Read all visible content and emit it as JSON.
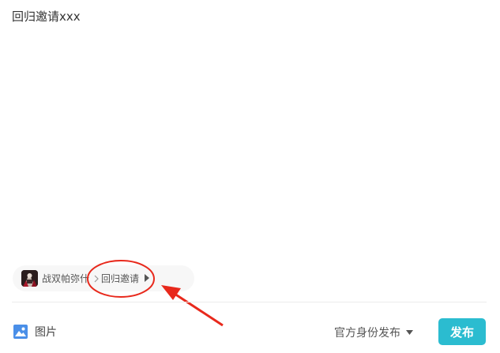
{
  "editor": {
    "content": "回归邀请xxx"
  },
  "topic": {
    "game_name": "战双帕弥什",
    "topic_name": "回归邀请"
  },
  "toolbar": {
    "image_label": "图片",
    "identity_label": "官方身份发布",
    "publish_label": "发布"
  },
  "icons": {
    "game": "game-avatar-icon",
    "separator": "chevron-right-icon",
    "topic_dropdown": "caret-right-icon",
    "image": "image-icon",
    "identity_dropdown": "caret-down-icon"
  },
  "colors": {
    "publish_button": "#2bbcd0",
    "image_icon": "#4a8fe8",
    "annotation": "#e8291c"
  }
}
